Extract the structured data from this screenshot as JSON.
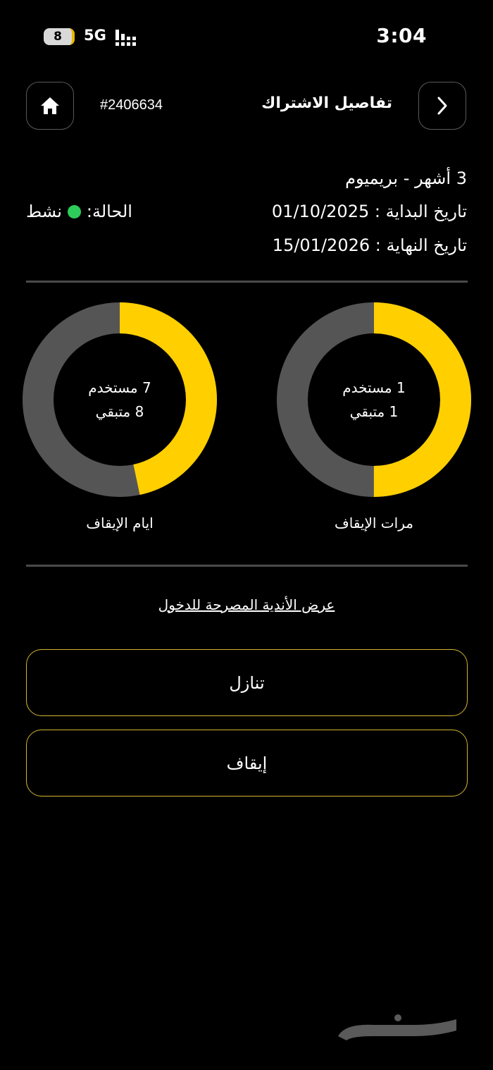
{
  "status_bar": {
    "time": "3:04",
    "battery_level": "8",
    "network": "5G"
  },
  "header": {
    "title": "تفاصيل الاشتراك",
    "subscription_id": "#2406634",
    "home_icon": "home-icon",
    "back_icon": "chevron-right-icon"
  },
  "subscription": {
    "plan": "3 أشهر - بريميوم",
    "start_date": "تاريخ البداية : 01/10/2025",
    "end_date": "تاريخ النهاية : 15/01/2026",
    "status_label": "الحالة:",
    "status_value": "نشط",
    "status_color": "#2ecc5a"
  },
  "charts": {
    "freezes": {
      "label": "مرات الإيقاف",
      "used_text": "1 مستخدم",
      "remaining_text": "1 متبقي",
      "used": 1,
      "remaining": 1
    },
    "freeze_days": {
      "label": "ايام الإيقاف",
      "used_text": "7 مستخدم",
      "remaining_text": "8 متبقي",
      "used": 7,
      "remaining": 8
    },
    "colors": {
      "used": "#ffcf00",
      "remaining": "#555555"
    }
  },
  "links": {
    "allowed_clubs": "عرض الأندية المصرحة للدخول"
  },
  "buttons": {
    "transfer": "تنازل",
    "freeze": "إيقاف"
  },
  "watermark": "حراج"
}
